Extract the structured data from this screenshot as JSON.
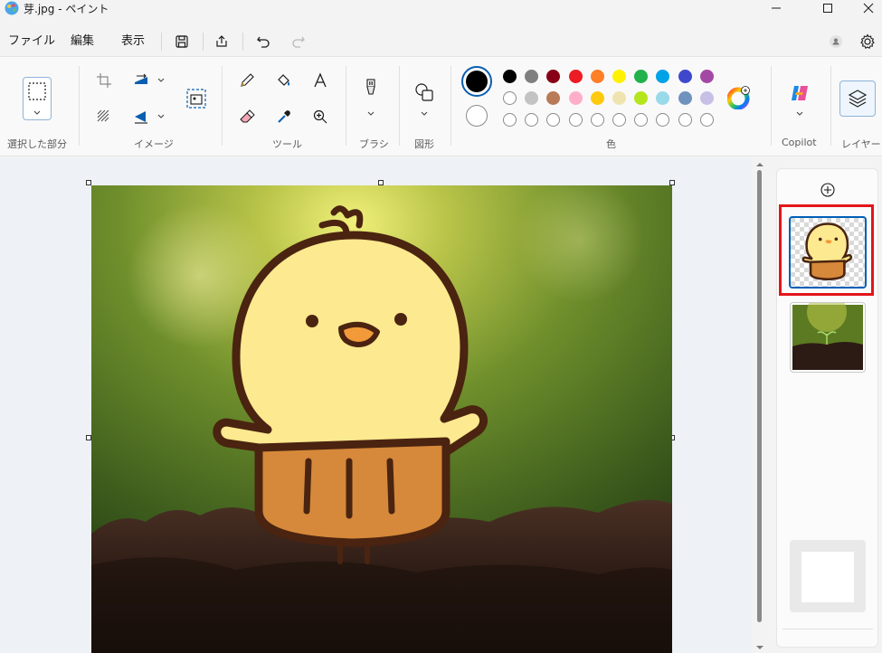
{
  "window": {
    "title": "芽.jpg - ペイント",
    "controls": [
      "minimize-icon",
      "maximize-icon",
      "close-icon"
    ]
  },
  "menu": {
    "file": "ファイル",
    "edit": "編集",
    "view": "表示",
    "icons": [
      "save-icon",
      "share-icon",
      "undo-icon",
      "redo-icon",
      "account-icon",
      "settings-icon"
    ]
  },
  "ribbon": {
    "selection_label": "選択した部分",
    "image_label": "イメージ",
    "tools_label": "ツール",
    "brush_label": "ブラシ",
    "shapes_label": "図形",
    "color_label": "色",
    "copilot_label": "Copilot",
    "layers_label": "レイヤー",
    "primary_color": "#000000",
    "secondary_color": "#ffffff",
    "palette_row1": [
      "#000000",
      "#7f7f7f",
      "#880015",
      "#ed1c24",
      "#ff7f27",
      "#fff200",
      "#22b14c",
      "#00a2e8",
      "#3f48cc",
      "#a349a4"
    ],
    "palette_row2": [
      "#ffffff",
      "#c3c3c3",
      "#b97a57",
      "#ffaec9",
      "#ffc90e",
      "#efe4b0",
      "#b5e61d",
      "#99d9ea",
      "#7092be",
      "#c8bfe7"
    ],
    "palette_row3_empty": 10
  },
  "layers_panel": {
    "add_icon": "add-layer-icon",
    "layers": [
      {
        "name": "chick-layer",
        "selected": true
      },
      {
        "name": "photo-layer",
        "selected": false
      }
    ]
  },
  "colors": {
    "accent": "#005fb8",
    "highlight": "#e3151a"
  }
}
